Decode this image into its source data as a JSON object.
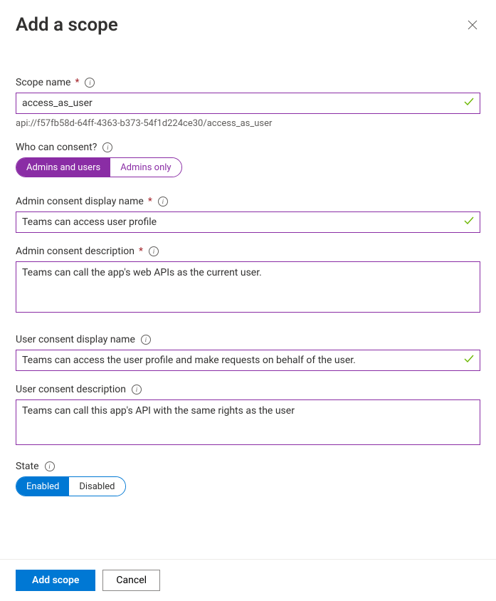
{
  "header": {
    "title": "Add a scope"
  },
  "scopeName": {
    "label": "Scope name",
    "value": "access_as_user",
    "helper": "api://f57fb58d-64ff-4363-b373-54f1d224ce30/access_as_user"
  },
  "consent": {
    "label": "Who can consent?",
    "options": {
      "admins_users": "Admins and users",
      "admins_only": "Admins only"
    }
  },
  "adminDisplay": {
    "label": "Admin consent display name",
    "value": "Teams can access user profile"
  },
  "adminDesc": {
    "label": "Admin consent description",
    "value": "Teams can call the app's web APIs as the current user."
  },
  "userDisplay": {
    "label": "User consent display name",
    "value": "Teams can access the user profile and make requests on behalf of the user."
  },
  "userDesc": {
    "label": "User consent description",
    "value": "Teams can call this app's API with the same rights as the user"
  },
  "state": {
    "label": "State",
    "options": {
      "enabled": "Enabled",
      "disabled": "Disabled"
    }
  },
  "footer": {
    "add": "Add scope",
    "cancel": "Cancel"
  }
}
